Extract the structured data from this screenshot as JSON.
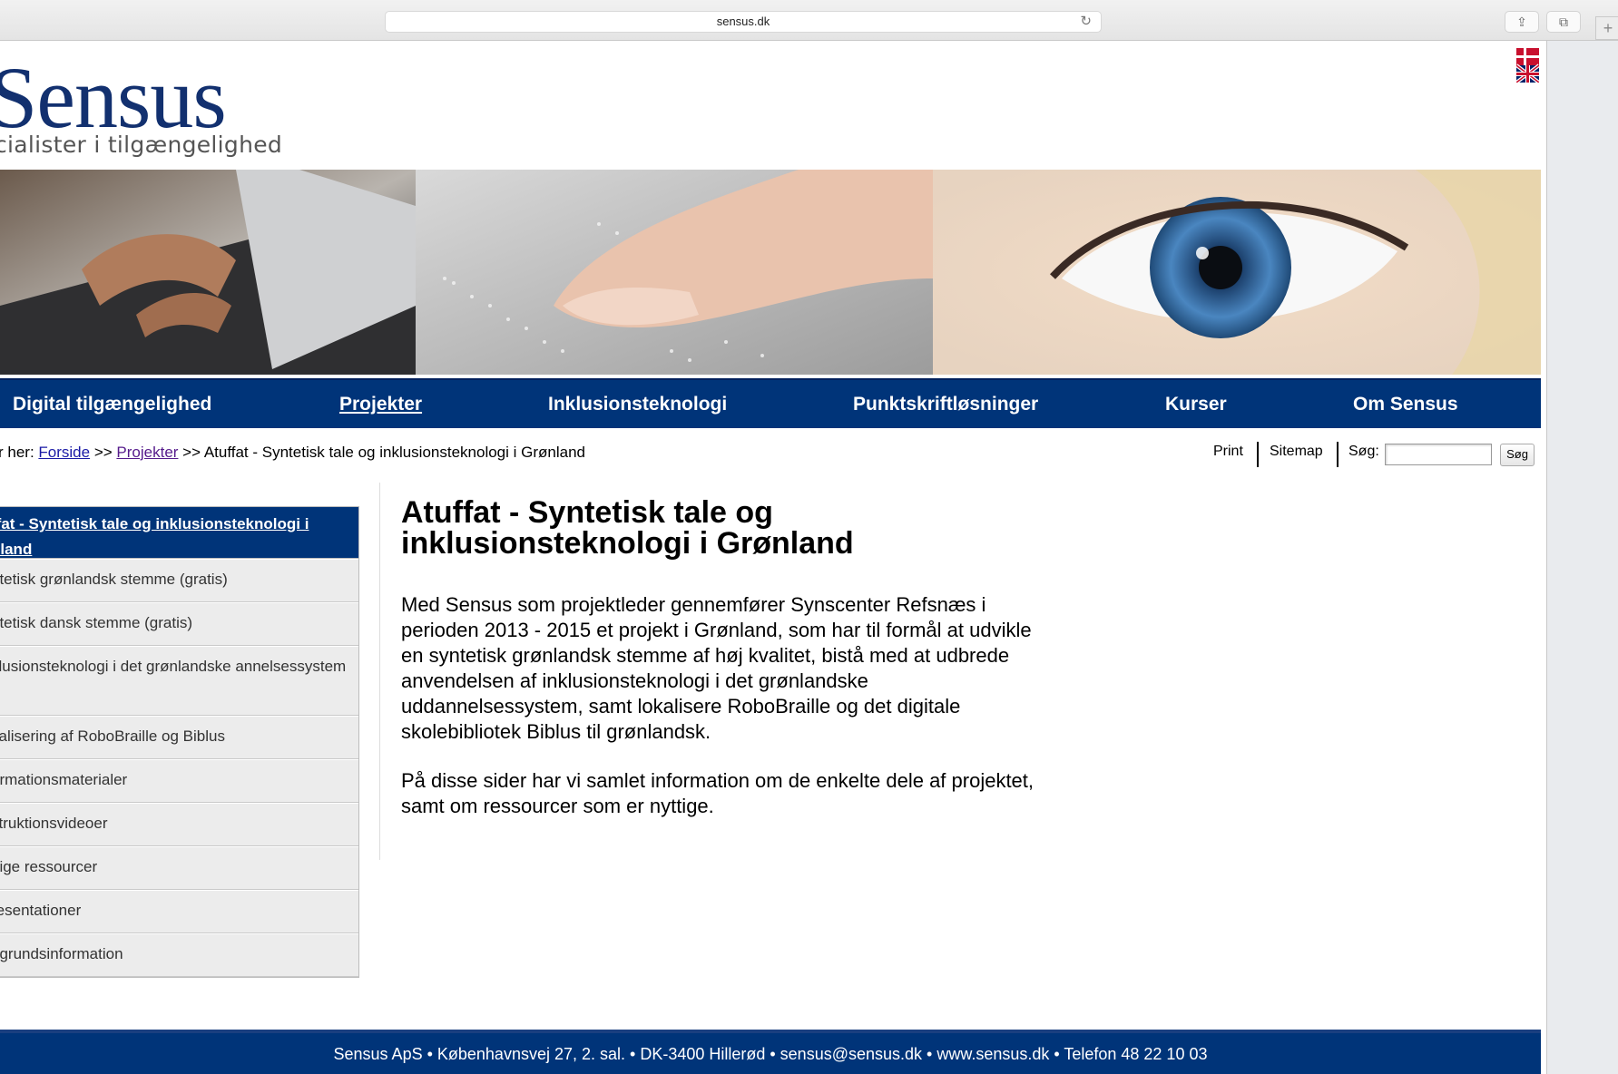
{
  "browser": {
    "url": "sensus.dk",
    "reload_icon": "reload-icon",
    "share_icon": "share-icon",
    "tabs_icon": "tabs-icon",
    "new_tab_icon": "plus-icon"
  },
  "header": {
    "logo": "Sensus",
    "tagline": "cialister i tilgængelighed",
    "language_flag": "danish-uk-flag-icon"
  },
  "nav": [
    {
      "label": "Digital tilgængelighed"
    },
    {
      "label": "Projekter"
    },
    {
      "label": "Inklusionsteknologi"
    },
    {
      "label": "Punktskriftløsninger"
    },
    {
      "label": "Kurser"
    },
    {
      "label": "Om Sensus"
    }
  ],
  "breadcrumb": {
    "prefix": "r her: ",
    "home": "Forside",
    "sep": " >> ",
    "section": "Projekter",
    "current": "Atuffat - Syntetisk tale og inklusionsteknologi i Grønland"
  },
  "tools": {
    "print": "Print",
    "sitemap": "Sitemap",
    "search_label": "Søg:",
    "search_value": "",
    "search_button": "Søg"
  },
  "sidebar": {
    "active": "ffat - Syntetisk tale og inklusionsteknologi i nland",
    "items": [
      {
        "label": "ntetisk grønlandsk stemme (gratis)"
      },
      {
        "label": "ntetisk dansk stemme (gratis)"
      },
      {
        "label": "klusionsteknologi i det grønlandske annelsessystem"
      },
      {
        "label": "kalisering af RoboBraille og Biblus"
      },
      {
        "label": "ormationsmaterialer"
      },
      {
        "label": "struktionsvideoer"
      },
      {
        "label": "ttige ressourcer"
      },
      {
        "label": "æsentationer"
      },
      {
        "label": "ggrundsinformation"
      }
    ]
  },
  "main": {
    "title": "Atuffat - Syntetisk tale og inklusionsteknologi i Grønland",
    "paragraph1": "Med Sensus som projektleder gennemfører Synscenter Refsnæs i perioden 2013 - 2015 et projekt i Grønland, som har til formål at udvikle en syntetisk grønlandsk stemme af høj kvalitet, bistå med at udbrede anvendelsen af inklusionsteknologi i det grønlandske uddannelsessystem, samt lokalisere RoboBraille og det digitale skolebibliotek Biblus til grønlandsk.",
    "paragraph2": "På disse sider har vi samlet information om de enkelte dele af projektet, samt om ressourcer som er nyttige."
  },
  "footer": {
    "text": "Sensus ApS • Københavnsvej 27, 2. sal. • DK-3400 Hillerød • sensus@sensus.dk • www.sensus.dk • Telefon 48 22 10 03"
  },
  "colors": {
    "brand_navy": "#003479",
    "logo_blue": "#12306f"
  }
}
